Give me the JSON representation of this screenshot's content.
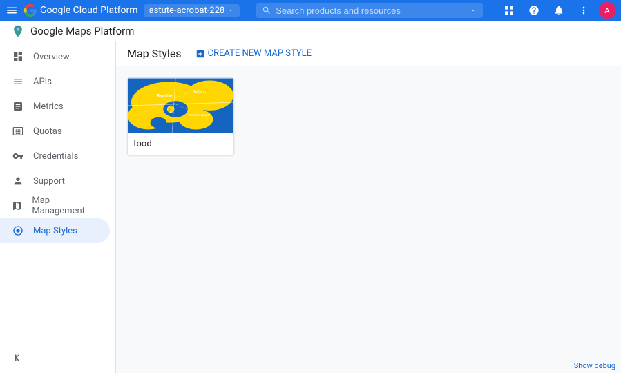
{
  "topbar": {
    "title": "Google Cloud Platform",
    "project": "astute-acrobat-228",
    "search_placeholder": "Search products and resources",
    "menu_icon": "☰",
    "search_icon": "🔍",
    "grid_icon": "⊞",
    "help_icon": "?",
    "bell_icon": "🔔",
    "more_icon": "⋮"
  },
  "subheader": {
    "title": "Google Maps Platform",
    "page_title": "Map Styles"
  },
  "create_button": "CREATE NEW MAP STYLE",
  "sidebar": {
    "items": [
      {
        "id": "overview",
        "label": "Overview",
        "icon": "⊙"
      },
      {
        "id": "apis",
        "label": "APIs",
        "icon": "☰"
      },
      {
        "id": "metrics",
        "label": "Metrics",
        "icon": "📊"
      },
      {
        "id": "quotas",
        "label": "Quotas",
        "icon": "🖥"
      },
      {
        "id": "credentials",
        "label": "Credentials",
        "icon": "🔑"
      },
      {
        "id": "support",
        "label": "Support",
        "icon": "👤"
      },
      {
        "id": "map-management",
        "label": "Map Management",
        "icon": "⊞"
      },
      {
        "id": "map-styles",
        "label": "Map Styles",
        "icon": "◎",
        "active": true
      }
    ]
  },
  "map_card": {
    "label": "food",
    "style_name": "food"
  },
  "bottom_bar": {
    "label": "Show debug"
  }
}
